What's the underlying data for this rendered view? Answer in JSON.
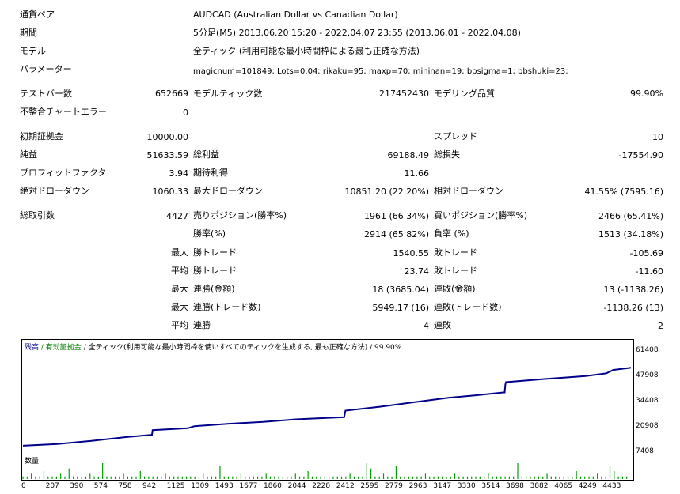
{
  "settings": [
    {
      "label": "通貨ペア",
      "value": "AUDCAD (Australian Dollar vs Canadian Dollar)"
    },
    {
      "label": "期間",
      "value": "5分足(M5) 2013.06.20 15:20 - 2022.04.07 23:55 (2013.06.01 - 2022.04.08)"
    },
    {
      "label": "モデル",
      "value": "全ティック (利用可能な最小時間枠による最も正確な方法)"
    },
    {
      "label": "パラメーター",
      "value": "magicnum=101849; Lots=0.04; rikaku=95; maxp=70; mininan=19; bbsigma=1; bbshuki=23;"
    }
  ],
  "stats": {
    "bars_label": "テストバー数",
    "bars": "652669",
    "ticks_label": "モデルティック数",
    "ticks": "217452430",
    "quality_label": "モデリング品質",
    "quality": "99.90%",
    "mismatch_label": "不整合チャートエラー",
    "mismatch": "0",
    "deposit_label": "初期証拠金",
    "deposit": "10000.00",
    "spread_label": "スプレッド",
    "spread": "10",
    "net_label": "純益",
    "net": "51633.59",
    "gross_profit_label": "総利益",
    "gross_profit": "69188.49",
    "gross_loss_label": "総損失",
    "gross_loss": "-17554.90",
    "pf_label": "プロフィットファクタ",
    "pf": "3.94",
    "ep_label": "期待利得",
    "ep": "11.66",
    "abs_dd_label": "絶対ドローダウン",
    "abs_dd": "1060.33",
    "max_dd_label": "最大ドローダウン",
    "max_dd": "10851.20 (22.20%)",
    "rel_dd_label": "相対ドローダウン",
    "rel_dd": "41.55% (7595.16)",
    "trades_label": "総取引数",
    "trades": "4427",
    "short_label": "売りポジション(勝率%)",
    "short": "1961 (66.34%)",
    "long_label": "買いポジション(勝率%)",
    "long": "2466 (65.41%)",
    "winrate_label": "勝率(%)",
    "winrate": "2914 (65.82%)",
    "lossrate_label": "負率 (%)",
    "lossrate": "1513 (34.18%)",
    "max_label": "最大",
    "avg_label": "平均",
    "max_win_label": "勝トレード",
    "max_win": "1540.55",
    "max_loss_label": "敗トレード",
    "max_loss": "-105.69",
    "avg_win_label": "勝トレード",
    "avg_win": "23.74",
    "avg_loss_label": "敗トレード",
    "avg_loss": "-11.60",
    "cons_win_money_label": "連勝(金額)",
    "cons_win_money": "18 (3685.04)",
    "cons_loss_money_label": "連敗(金額)",
    "cons_loss_money": "13 (-1138.26)",
    "cons_win_count_label": "連勝(トレード数)",
    "cons_win_count": "5949.17 (16)",
    "cons_loss_count_label": "連敗(トレード数)",
    "cons_loss_count": "-1138.26 (13)",
    "avg_cons_win_label": "連勝",
    "avg_cons_win": "4",
    "avg_cons_loss_label": "連敗",
    "avg_cons_loss": "2"
  },
  "chart": {
    "legend_balance": "残高",
    "legend_equity": "有効証拠金",
    "legend_rest": "/ 全ティック(利用可能な最小時間枠を使いすべてのティックを生成する, 最も正確な方法) / 99.90%",
    "volume_label": "数量",
    "colors": {
      "balance": "#00008b",
      "volume": "#00a000"
    }
  },
  "chart_data": {
    "type": "line",
    "series": [
      {
        "name": "残高",
        "x": [
          0,
          250,
          500,
          750,
          940,
          945,
          1200,
          1250,
          1500,
          1750,
          2000,
          2340,
          2350,
          2600,
          2850,
          3100,
          3300,
          3500,
          3510,
          3515,
          3520,
          3800,
          4100,
          4250,
          4300,
          4430
        ],
        "values": [
          10000,
          10900,
          12600,
          14600,
          15800,
          18300,
          19300,
          20400,
          21700,
          22700,
          24100,
          25200,
          28700,
          30800,
          33200,
          35600,
          36900,
          38400,
          38400,
          42700,
          43900,
          45600,
          47200,
          48600,
          50400,
          51634
        ]
      }
    ],
    "ylim": [
      7408,
      61408
    ],
    "y_ticks": [
      "61408",
      "47908",
      "34408",
      "20908",
      "7408"
    ],
    "x_ticks": [
      "0",
      "207",
      "390",
      "574",
      "758",
      "942",
      "1125",
      "1309",
      "1493",
      "1677",
      "1860",
      "2044",
      "2228",
      "2412",
      "2595",
      "2779",
      "2963",
      "3147",
      "3330",
      "3514",
      "3698",
      "3882",
      "4065",
      "4249",
      "4433"
    ],
    "volume": [
      1,
      1,
      2,
      1,
      1,
      3,
      1,
      1,
      1,
      2,
      1,
      4,
      1,
      1,
      1,
      1,
      2,
      1,
      1,
      6,
      1,
      1,
      1,
      1,
      2,
      1,
      1,
      1,
      3,
      1,
      1,
      1,
      1,
      1,
      2,
      1,
      1,
      1,
      1,
      1,
      1,
      1,
      1,
      2,
      1,
      1,
      1,
      5,
      1,
      1,
      1,
      1,
      2,
      1,
      1,
      1,
      1,
      1,
      2,
      1,
      1,
      1,
      1,
      1,
      1,
      2,
      1,
      1,
      3,
      1,
      1,
      1,
      1,
      1,
      1,
      1,
      1,
      1,
      2,
      1,
      1,
      1,
      6,
      4,
      1,
      1,
      2,
      1,
      1,
      5,
      1,
      1,
      1,
      1,
      1,
      1,
      2,
      1,
      1,
      1,
      1,
      1,
      1,
      2,
      1,
      1,
      1,
      1,
      1,
      1,
      1,
      2,
      1,
      1,
      1,
      1,
      1,
      1,
      6,
      1,
      1,
      1,
      1,
      1,
      1,
      2,
      1,
      1,
      1,
      1,
      1,
      1,
      3,
      1,
      1,
      1,
      1,
      2,
      1,
      1,
      5,
      3,
      1,
      1,
      1
    ]
  }
}
